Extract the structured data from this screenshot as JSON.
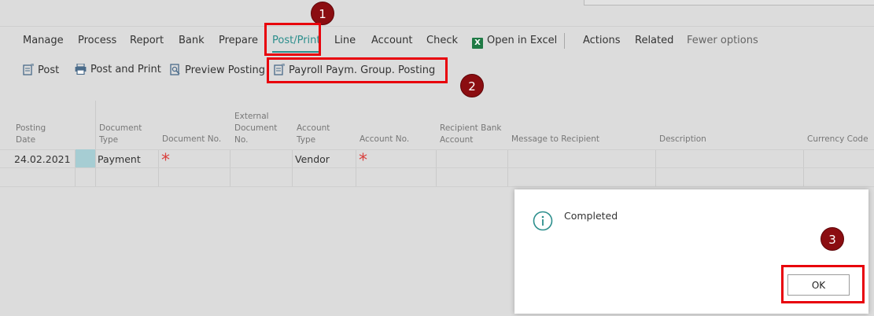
{
  "menu": {
    "items": [
      {
        "label": "Manage"
      },
      {
        "label": "Process"
      },
      {
        "label": "Report"
      },
      {
        "label": "Bank"
      },
      {
        "label": "Prepare"
      },
      {
        "label": "Post/Print"
      },
      {
        "label": "Line"
      },
      {
        "label": "Account"
      },
      {
        "label": "Check"
      },
      {
        "label": "Open in Excel"
      },
      {
        "label": "Actions"
      },
      {
        "label": "Related"
      },
      {
        "label": "Fewer options"
      }
    ]
  },
  "subbar": {
    "items": [
      {
        "label": "Post"
      },
      {
        "label": "Post and Print"
      },
      {
        "label": "Preview Posting"
      },
      {
        "label": "Payroll Paym. Group. Posting"
      }
    ]
  },
  "badges": [
    "1",
    "2",
    "3"
  ],
  "grid": {
    "headers": {
      "posting_date": "Posting Date",
      "document_type": "Document Type",
      "document_no": "Document No.",
      "external_document_no": "External Document No.",
      "account_type": "Account Type",
      "account_no": "Account No.",
      "recipient_bank_account": "Recipient Bank Account",
      "message_to_recipient": "Message to Recipient",
      "description": "Description",
      "currency_code": "Currency Code"
    },
    "row": {
      "posting_date": "24.02.2021",
      "document_type": "Payment",
      "account_type": "Vendor",
      "required_mark": "*"
    }
  },
  "dialog": {
    "message": "Completed",
    "ok_label": "OK"
  },
  "colors": {
    "accent": "#2b8e8c",
    "highlight": "#e8000b",
    "badge": "#8b0d11",
    "required": "#d9403d"
  }
}
